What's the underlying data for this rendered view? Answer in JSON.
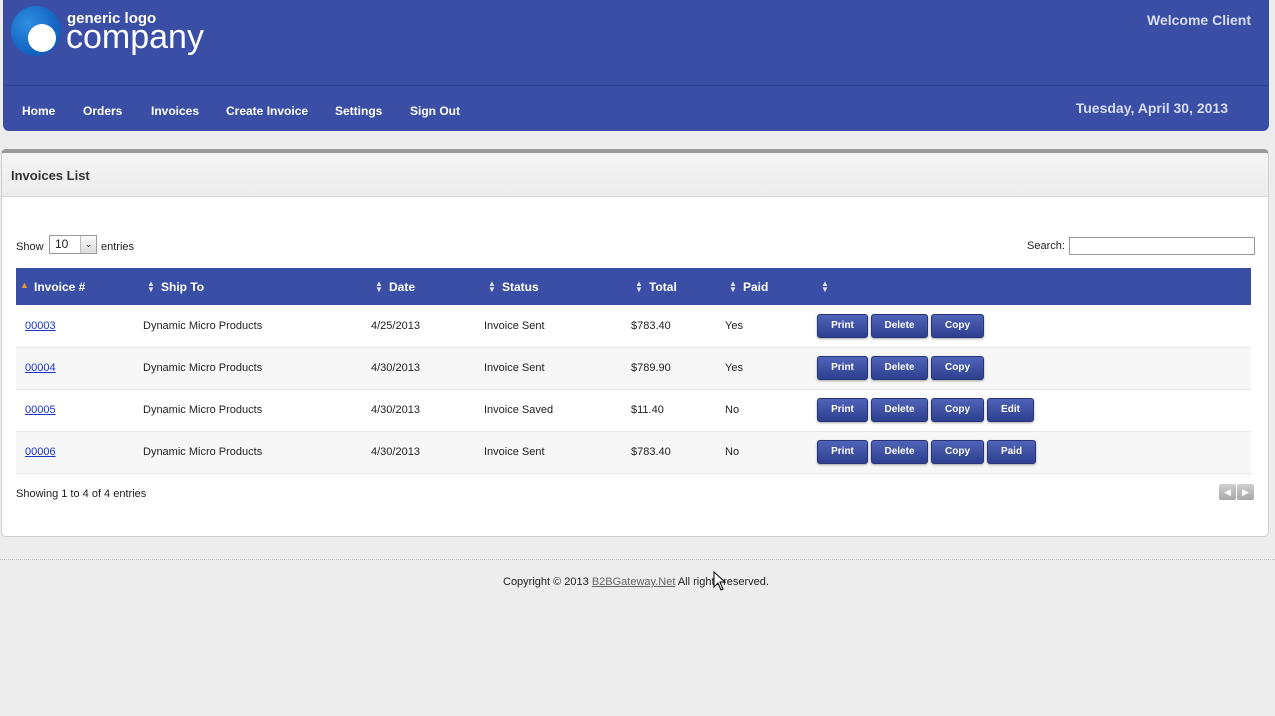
{
  "header": {
    "logo_small": "generic logo",
    "logo_big": "company",
    "welcome": "Welcome Client",
    "date": "Tuesday, April 30, 2013"
  },
  "nav": [
    "Home",
    "Orders",
    "Invoices",
    "Create Invoice",
    "Settings",
    "Sign Out"
  ],
  "panel": {
    "title": "Invoices List"
  },
  "controls": {
    "show": "Show",
    "length_value": "10",
    "entries": "entries",
    "search_label": "Search:"
  },
  "table": {
    "headers": [
      "Invoice #",
      "Ship To",
      "Date",
      "Status",
      "Total",
      "Paid",
      ""
    ],
    "rows": [
      {
        "invoice": "00003",
        "ship_to": "Dynamic Micro Products",
        "date": "4/25/2013",
        "status": "Invoice Sent",
        "total": "$783.40",
        "paid": "Yes",
        "actions": [
          "Print",
          "Delete",
          "Copy"
        ]
      },
      {
        "invoice": "00004",
        "ship_to": "Dynamic Micro Products",
        "date": "4/30/2013",
        "status": "Invoice Sent",
        "total": "$789.90",
        "paid": "Yes",
        "actions": [
          "Print",
          "Delete",
          "Copy"
        ]
      },
      {
        "invoice": "00005",
        "ship_to": "Dynamic Micro Products",
        "date": "4/30/2013",
        "status": "Invoice Saved",
        "total": "$11.40",
        "paid": "No",
        "actions": [
          "Print",
          "Delete",
          "Copy",
          "Edit"
        ]
      },
      {
        "invoice": "00006",
        "ship_to": "Dynamic Micro Products",
        "date": "4/30/2013",
        "status": "Invoice Sent",
        "total": "$783.40",
        "paid": "No",
        "actions": [
          "Print",
          "Delete",
          "Copy",
          "Paid"
        ]
      }
    ]
  },
  "info": "Showing 1 to 4 of 4 entries",
  "footer": {
    "prefix": "Copyright © 2013 ",
    "link": "B2BGateway.Net",
    "suffix": " All rights reserved."
  },
  "colors": {
    "brand": "#3a4ea6",
    "button": "#3b4fa6",
    "link": "#1a34c8",
    "sort_active": "#e89a36"
  },
  "icons": {
    "sort": "sort-both-icon",
    "sort_asc": "sort-asc-icon",
    "prev": "prev-page-icon",
    "next": "next-page-icon"
  }
}
